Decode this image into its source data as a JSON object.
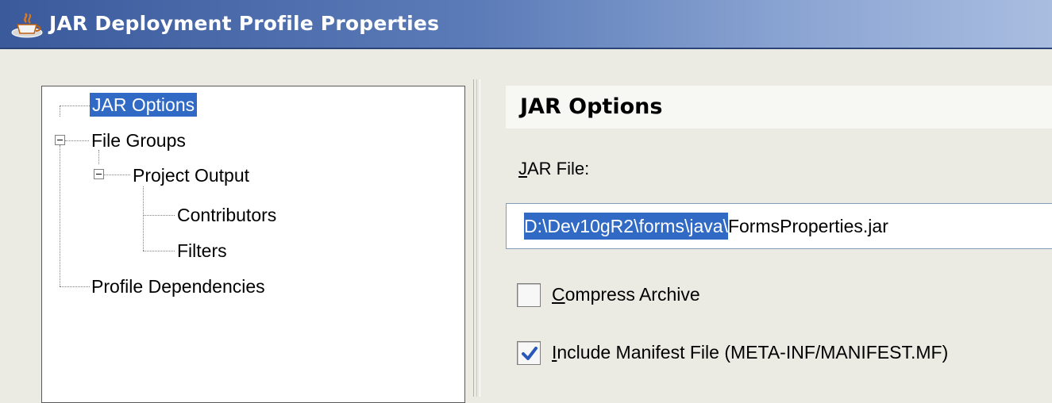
{
  "window": {
    "title": "JAR Deployment Profile Properties",
    "icon": "java-cup-icon"
  },
  "nav_tree": {
    "items": [
      {
        "label": "JAR Options",
        "selected": true
      },
      {
        "label": "File Groups",
        "expanded": true
      },
      {
        "label": "Project Output",
        "expanded": true
      },
      {
        "label": "Contributors"
      },
      {
        "label": "Filters"
      },
      {
        "label": "Profile Dependencies"
      }
    ]
  },
  "panel": {
    "header": "JAR Options",
    "jar_file": {
      "label_mnemonic": "J",
      "label_rest": "AR File:",
      "value_selected": "D:\\Dev10gR2\\forms\\java\\",
      "value_rest": "FormsProperties.jar"
    },
    "compress_archive": {
      "label_mnemonic": "C",
      "label_rest": "ompress Archive",
      "checked": false
    },
    "include_manifest": {
      "label_mnemonic": "I",
      "label_rest": "nclude Manifest File (META-INF/MANIFEST.MF)",
      "checked": true
    }
  },
  "colors": {
    "selection": "#316ac5",
    "titlebar_start": "#3a5a9c",
    "titlebar_end": "#a9bde0",
    "dialog_bg": "#ebebe3",
    "checkmark": "#2a58b8"
  }
}
